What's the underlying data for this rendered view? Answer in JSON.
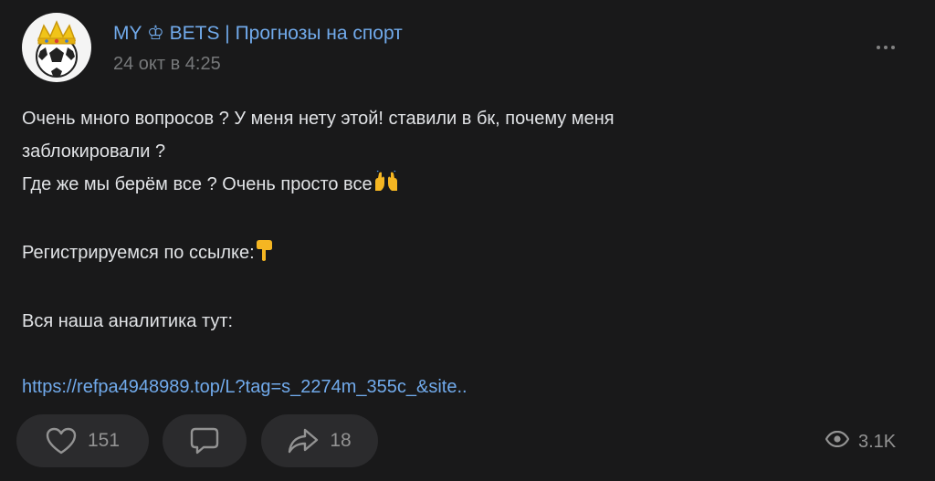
{
  "post": {
    "channel_name": "MY ♔ BETS | Прогнозы на спорт",
    "timestamp": "24 окт в 4:25",
    "lines": [
      "Очень много вопросов ? У меня нету этой! ставили в бк, почему меня",
      "заблокировали ?",
      "Где же мы берём все ? Очень просто все"
    ],
    "register_text": "Регистрируемся по ссылке:",
    "analytics_text": "Вся наша аналитика тут:",
    "link_text": "https://refpa4948989.top/L?tag=s_2274m_355c_&site.."
  },
  "actions": {
    "likes": "151",
    "shares": "18",
    "views": "3.1K"
  },
  "icons": {
    "avatar": "crowned-soccer-ball-avatar",
    "more": "more-dots-icon",
    "raised_hands": "raised-hands-emoji",
    "point_down": "pointing-down-emoji",
    "like": "heart-icon",
    "comment": "comment-icon",
    "share": "share-arrow-icon",
    "views": "eye-icon"
  },
  "colors": {
    "background": "#19191a",
    "text": "#e1e3e6",
    "accent": "#71aaeb",
    "muted": "#76787a",
    "button_bg": "#2b2b2d"
  }
}
